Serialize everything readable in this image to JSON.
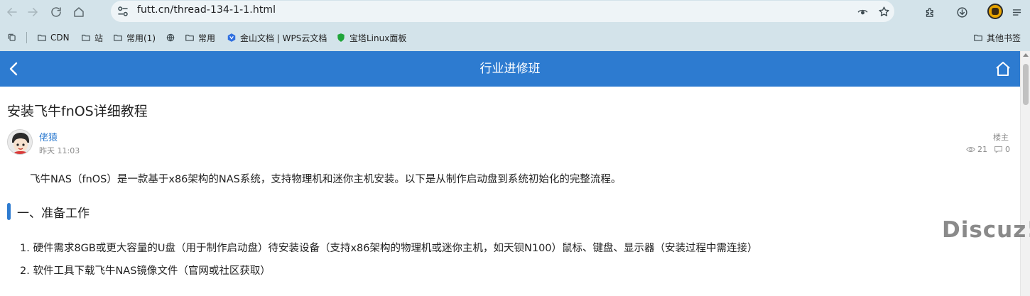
{
  "browser": {
    "url": "futt.cn/thread-134-1-1.html",
    "bookmarks": [
      {
        "icon": "folder-icon",
        "label": "CDN"
      },
      {
        "icon": "folder-icon",
        "label": "站"
      },
      {
        "icon": "folder-icon",
        "label": "常用(1)"
      },
      {
        "icon": "globe-icon",
        "label": ""
      },
      {
        "icon": "folder-icon",
        "label": "常用"
      },
      {
        "icon": "kdocs-icon",
        "label": "金山文档 | WPS云文档"
      },
      {
        "icon": "shield-icon",
        "label": "宝塔Linux面板"
      }
    ],
    "other_bookmarks": "其他书签"
  },
  "header": {
    "title": "行业进修班"
  },
  "post": {
    "title": "安装飞牛fnOS详细教程",
    "author": "佬猿",
    "time": "昨天 11:03",
    "floor": "楼主",
    "views": "21",
    "replies": "0",
    "intro": "飞牛NAS（fnOS）是一款基于x86架构的NAS系统，支持物理机和迷你主机安装。以下是从制作启动盘到系统初始化的完整流程。",
    "section_title": "一、准备工作",
    "list": [
      "1. 硬件需求8GB或更大容量的U盘（用于制作启动盘）待安装设备（支持x86架构的物理机或迷你主机，如天钡N100）鼠标、键盘、显示器（安装过程中需连接）",
      "2. 软件工具下载飞牛NAS镜像文件（官网或社区获取）"
    ]
  },
  "watermark": "Discuz!",
  "colors": {
    "chrome": "#d3e3ea",
    "header": "#2d7bd0",
    "link": "#2d7bd0"
  }
}
